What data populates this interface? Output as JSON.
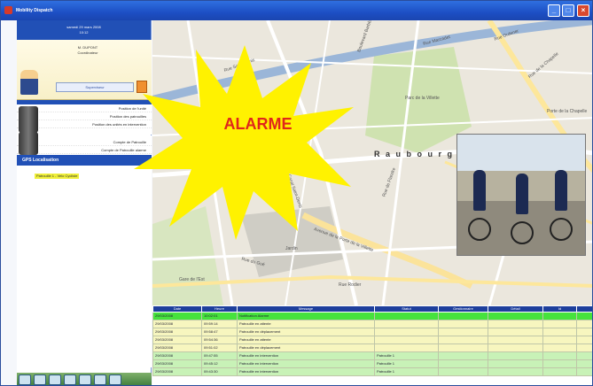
{
  "window": {
    "title": "Mobility Dispatch"
  },
  "left_panel": {
    "header_lines": [
      "samedi 29 mars 2008",
      "10:12"
    ],
    "profile": {
      "name": "M. DUPONT",
      "role": "Coordinateur",
      "field_value": "Superviseur"
    },
    "actions_group_1": [
      "Position de l'unité",
      "Position des patrouilles",
      "Position des unités en intervention"
    ],
    "actions_group_2": [
      "Compte de Patrouille",
      "Compte de Patrouille alarme"
    ],
    "gps_title": "GPS Localisation",
    "gps_items": [
      "Patrouille 1 - Velo Cycliste"
    ]
  },
  "map": {
    "labels": [
      "Rue Saint-Denis",
      "Boulevard Barbès",
      "Rue Marcadet",
      "Rue Ordener",
      "Rue de la Chapelle",
      "Parc de la Villette",
      "Porte de la Chapelle",
      "Canal Saint-Denis",
      "Rue de Flandre",
      "Avenue de la Porte de la Villette",
      "Jardin",
      "Rue du Gué",
      "Gare de l'Est",
      "Rue Rodier"
    ],
    "street_big": "R a u b o u r g",
    "alarm_text": "ALARME"
  },
  "events": {
    "columns": [
      "Date",
      "Heure",
      "Message",
      "Statut",
      "Gestionnaire",
      "Détail",
      "Id",
      ""
    ],
    "rows": [
      {
        "style": "g1",
        "cells": [
          "29/03/2008",
          "10:02:01",
          "Notification Alarme",
          "",
          "",
          "",
          "",
          ""
        ]
      },
      {
        "style": "y",
        "cells": [
          "29/03/2008",
          "09:59:14",
          "Patrouille en attente",
          "",
          "",
          "",
          "",
          ""
        ]
      },
      {
        "style": "y",
        "cells": [
          "29/03/2008",
          "09:58:47",
          "Patrouille en déplacement",
          "",
          "",
          "",
          "",
          ""
        ]
      },
      {
        "style": "y",
        "cells": [
          "29/03/2008",
          "09:54:36",
          "Patrouille en attente",
          "",
          "",
          "",
          "",
          ""
        ]
      },
      {
        "style": "y",
        "cells": [
          "29/03/2008",
          "09:51:02",
          "Patrouille en déplacement",
          "",
          "",
          "",
          "",
          ""
        ]
      },
      {
        "style": "g",
        "cells": [
          "29/03/2008",
          "09:47:55",
          "Patrouille en intervention",
          "Patrouille 1",
          "",
          "",
          "",
          ""
        ]
      },
      {
        "style": "g",
        "cells": [
          "29/03/2008",
          "09:45:12",
          "Patrouille en intervention",
          "Patrouille 1",
          "",
          "",
          "",
          ""
        ]
      },
      {
        "style": "g",
        "cells": [
          "29/03/2008",
          "09:43:30",
          "Patrouille en intervention",
          "Patrouille 1",
          "",
          "",
          "",
          ""
        ]
      }
    ]
  },
  "colors": {
    "accent": "#2150b6",
    "alarm": "#e0261b",
    "star": "#fff200"
  }
}
